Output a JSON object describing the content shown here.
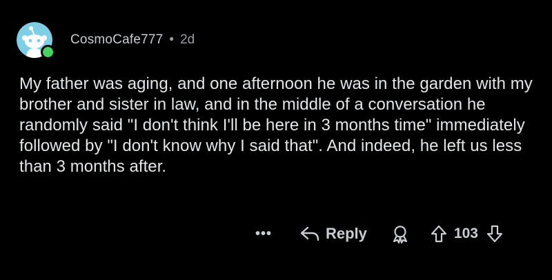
{
  "comment": {
    "author": "CosmoCafe777",
    "separator": "•",
    "age": "2d",
    "body": "My father was aging, and one afternoon he was in the garden with my brother and sister in law, and in the middle of a conversation he randomly said \"I don't think I'll be here in 3 months time\" immediately followed by \"I don't know why I said that\". And indeed, he left us less than 3 months after.",
    "online": true
  },
  "actions": {
    "more_label": "•••",
    "reply_label": "Reply",
    "score": "103"
  },
  "colors": {
    "background": "#000000",
    "avatar_background": "#7ecfe6",
    "online_dot": "#46d160",
    "text": "#e3e5e7",
    "muted": "#9a9da0"
  },
  "icons": {
    "more": "more-options-icon",
    "reply": "reply-arrow-icon",
    "award": "award-icon",
    "upvote": "upvote-arrow-icon",
    "downvote": "downvote-arrow-icon"
  }
}
